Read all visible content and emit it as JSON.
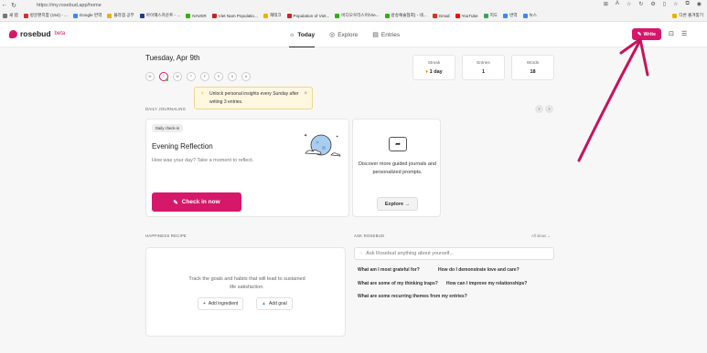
{
  "browser": {
    "url": "https://my.rosebud.app/home",
    "bookmarks": [
      {
        "label": "새 탭",
        "color": "#777"
      },
      {
        "label": "방문편지함 (154) - ...",
        "color": "#c33"
      },
      {
        "label": "Google 번역",
        "color": "#4285f4"
      },
      {
        "label": "플라겜 공부",
        "color": "#e4b400"
      },
      {
        "label": "아이웨스카운트 - ...",
        "color": "#1c3c8c"
      },
      {
        "label": "NAVER",
        "color": "#2db400"
      },
      {
        "label": "Viet Nam Populatio...",
        "color": "#c22"
      },
      {
        "label": "재테크",
        "color": "#e4b400"
      },
      {
        "label": "Population of Viet...",
        "color": "#c22"
      },
      {
        "label": "비디오우리스어/Vie...",
        "color": "#2db400"
      },
      {
        "label": "방송예술협회) - 네...",
        "color": "#2db400"
      },
      {
        "label": "Gmail",
        "color": "#d93025"
      },
      {
        "label": "YouTube",
        "color": "#ff0000"
      },
      {
        "label": "지도",
        "color": "#34a853"
      },
      {
        "label": "번역",
        "color": "#4285f4"
      },
      {
        "label": "뉴스",
        "color": "#4285f4"
      }
    ],
    "other_bookmarks": "다른 즐겨찾기"
  },
  "header": {
    "logo": "rosebud",
    "beta": "beta",
    "nav": [
      {
        "label": "Today",
        "icon": "☼"
      },
      {
        "label": "Explore",
        "icon": "◎"
      },
      {
        "label": "Entries",
        "icon": "▤"
      }
    ],
    "write": "Write"
  },
  "today": {
    "date": "Tuesday, Apr 9th",
    "days": [
      "M",
      "T",
      "W",
      "T",
      "F",
      "S",
      "S"
    ],
    "stats": [
      {
        "label": "Streak",
        "value": "1 day"
      },
      {
        "label": "Entries",
        "value": "1"
      },
      {
        "label": "Words",
        "value": "18"
      }
    ],
    "tip": "Unlock personal insights every Sunday after writing 3 entries."
  },
  "journaling": {
    "section": "DAILY JOURNALING",
    "badge": "Daily check-in",
    "title": "Evening Reflection",
    "subtitle": "How was your day? Take a moment to reflect.",
    "checkin": "Check in now",
    "discover": "Discover more guided journals and personalized prompts.",
    "explore": "Explore →"
  },
  "happiness": {
    "section": "HAPPINESS RECIPE",
    "text": "Track the goals and habits that will lead to sustained life satisfaction.",
    "add_ingredient": "Add ingredient",
    "add_goal": "Add goal"
  },
  "ask": {
    "section": "ASK ROSEBUD",
    "all_ideas": "All ideas ⌄",
    "placeholder": "Ask Rosebud anything about yourself...",
    "questions": [
      "What am I most grateful for?",
      "How do I demonstrate love and care?",
      "What are some of my thinking traps?",
      "How can I improve my relationships?",
      "What are some recurring themes from my entries?"
    ]
  },
  "colors": {
    "brand": "#d6186a",
    "annotation": "#c8125c"
  }
}
